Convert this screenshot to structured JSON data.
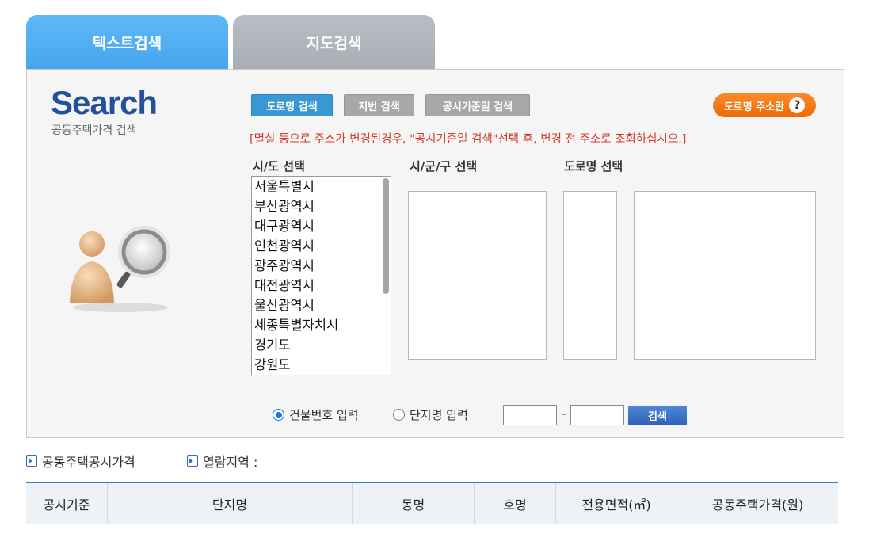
{
  "tabs": {
    "text_search": "텍스트검색",
    "map_search": "지도검색"
  },
  "logo": {
    "title": "Search",
    "subtitle": "공동주택가격 검색"
  },
  "search_type_buttons": {
    "road": "도로명 검색",
    "jibun": "지번 검색",
    "date": "공시기준일 검색"
  },
  "help_button": {
    "label": "도로명 주소란",
    "icon": "question-mark-icon"
  },
  "notice": "[멸실 등으로 주소가 변경된경우, \"공시기준일 검색\"선택 후, 변경 전 주소로 조회하십시오.]",
  "columns": {
    "sido": "시/도 선택",
    "sigungu": "시/군/구 선택",
    "road": "도로명 선택"
  },
  "sido_options": [
    "서울특별시",
    "부산광역시",
    "대구광역시",
    "인천광역시",
    "광주광역시",
    "대전광역시",
    "울산광역시",
    "세종특별자치시",
    "경기도",
    "강원도"
  ],
  "input_mode": {
    "building_number": "건물번호 입력",
    "complex_name": "단지명 입력",
    "selected": "building_number"
  },
  "building_number": {
    "main": "",
    "sub": "",
    "separator": "-"
  },
  "search_button": "검색",
  "breadcrumb": {
    "first": "공동주택공시가격",
    "second": "열람지역 :"
  },
  "table_headers": [
    "공시기준",
    "단지명",
    "동명",
    "호명",
    "전용면적(㎡)",
    "공동주택가격(원)"
  ],
  "colors": {
    "tab_active": "#46a6ee",
    "tab_inactive": "#a9adb4",
    "road_button": "#3a98d3",
    "help_button": "#ec6a07",
    "notice": "#d43a2a",
    "logo": "#24519b",
    "table_border": "#3e7ac8"
  }
}
